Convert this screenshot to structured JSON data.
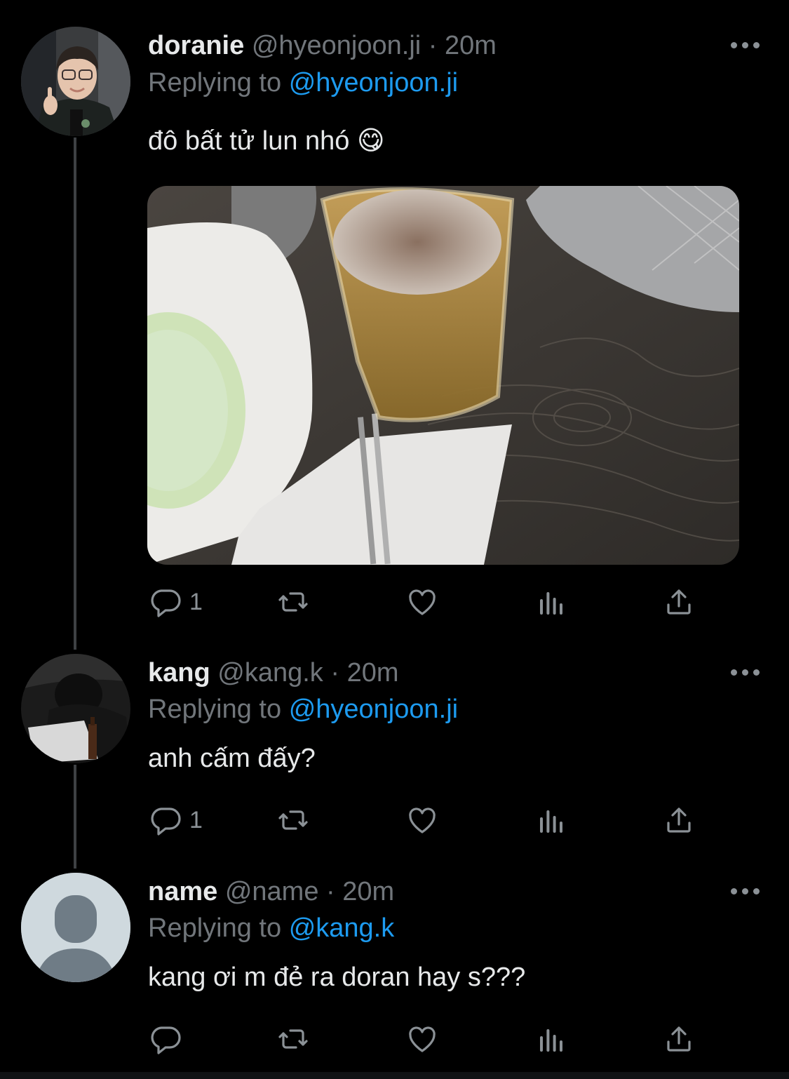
{
  "tweets": [
    {
      "display_name": "doranie",
      "handle": "@hyeonjoon.ji",
      "separator": "·",
      "time": "20m",
      "replying_label": "Replying to",
      "replying_to": "@hyeonjoon.ji",
      "text": "đô bất tử lun nhó 😋",
      "has_photo": true,
      "reply_count": "1"
    },
    {
      "display_name": "kang",
      "handle": "@kang.k",
      "separator": "·",
      "time": "20m",
      "replying_label": "Replying to",
      "replying_to": "@hyeonjoon.ji",
      "text": "anh cấm đấy?",
      "has_photo": false,
      "reply_count": "1"
    },
    {
      "display_name": "name",
      "handle": "@name",
      "separator": "·",
      "time": "20m",
      "replying_label": "Replying to",
      "replying_to": "@kang.k",
      "text": "kang ơi m đẻ ra doran hay s???",
      "has_photo": false,
      "reply_count": ""
    }
  ],
  "icons": {
    "reply": "reply-icon",
    "retweet": "retweet-icon",
    "like": "heart-icon",
    "views": "analytics-icon",
    "share": "share-icon",
    "more": "more-icon"
  },
  "colors": {
    "background": "#000000",
    "text": "#e7e9ea",
    "secondary": "#71767b",
    "mention": "#1d9bf0",
    "icon": "#8b9196",
    "thread_line": "#3e4144"
  }
}
